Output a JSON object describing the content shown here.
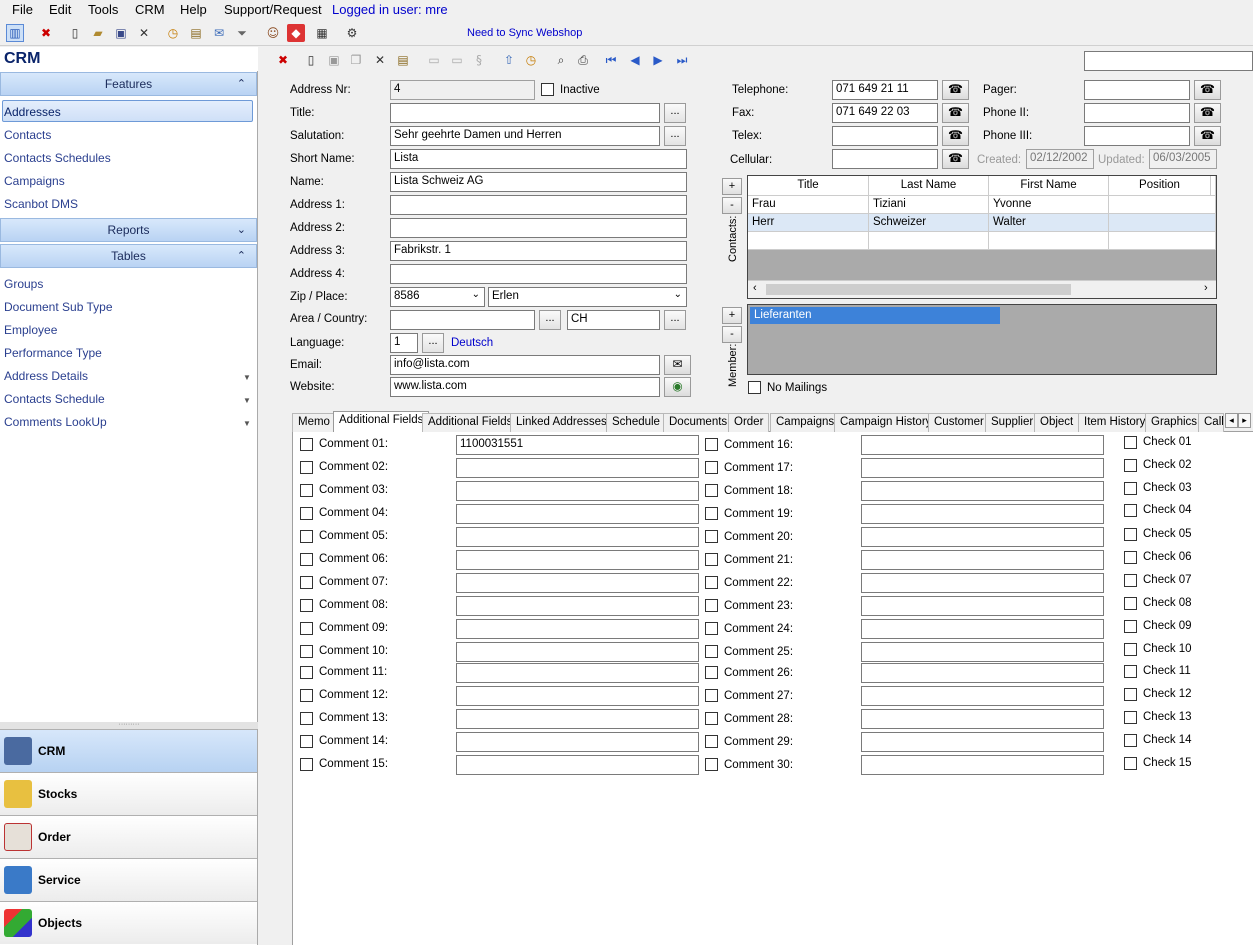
{
  "menu": {
    "items": [
      "File",
      "Edit",
      "Tools",
      "CRM",
      "Help",
      "Support/Request"
    ],
    "login_text": "Logged in user: mre"
  },
  "toolbar": {
    "sync_link": "Need to Sync Webshop"
  },
  "left": {
    "title": "CRM",
    "features_header": "Features",
    "features": [
      "Addresses",
      "Contacts",
      "Contacts  Schedules",
      "Campaigns",
      "Scanbot DMS"
    ],
    "reports_header": "Reports",
    "tables_header": "Tables",
    "tables": [
      "Groups",
      "Document Sub Type",
      "Employee",
      "Performance Type",
      "Address Details",
      "Contacts  Schedule",
      "Comments LookUp"
    ],
    "modules": [
      "CRM",
      "Stocks",
      "Order",
      "Service",
      "Objects"
    ]
  },
  "form": {
    "address_nr_label": "Address Nr:",
    "address_nr": "4",
    "inactive_label": "Inactive",
    "title_label": "Title:",
    "title": "",
    "salutation_label": "Salutation:",
    "salutation": "Sehr geehrte Damen und Herren",
    "short_name_label": "Short Name:",
    "short_name": "Lista",
    "name_label": "Name:",
    "name": "Lista Schweiz AG",
    "address1_label": "Address 1:",
    "address1": "",
    "address2_label": "Address 2:",
    "address2": "",
    "address3_label": "Address 3:",
    "address3": "Fabrikstr. 1",
    "address4_label": "Address 4:",
    "address4": "",
    "zip_label": "Zip / Place:",
    "zip": "8586",
    "place": "Erlen",
    "area_label": "Area / Country:",
    "area": "",
    "country": "CH",
    "language_label": "Language:",
    "language_nr": "1",
    "language_name": "Deutsch",
    "email_label": "Email:",
    "email": "info@lista.com",
    "website_label": "Website:",
    "website": "www.lista.com",
    "telephone_label": "Telephone:",
    "telephone": "071 649 21 11",
    "fax_label": "Fax:",
    "fax": "071 649 22 03",
    "telex_label": "Telex:",
    "telex": "",
    "cellular_label": "Cellular:",
    "cellular": "",
    "pager_label": "Pager:",
    "pager": "",
    "phone2_label": "Phone II:",
    "phone2": "",
    "phone3_label": "Phone III:",
    "phone3": "",
    "created_label": "Created:",
    "created": "02/12/2002",
    "updated_label": "Updated:",
    "updated": "06/03/2005",
    "no_mailings_label": "No Mailings"
  },
  "contacts": {
    "side_label": "Contacts:",
    "headers": [
      "Title",
      "Last Name",
      "First Name",
      "Position"
    ],
    "rows": [
      [
        "Frau",
        "Tiziani",
        "Yvonne",
        ""
      ],
      [
        "Herr",
        "Schweizer",
        "Walter",
        ""
      ]
    ]
  },
  "member": {
    "side_label": "Member:",
    "groups": [
      "Lieferanten"
    ]
  },
  "tabs": [
    "Memo",
    "Additional Fields",
    "Additional Fields",
    "Linked Addresses",
    "Schedule",
    "Documents",
    "Order",
    "Campaigns",
    "Campaign History",
    "Customer",
    "Supplier",
    "Object",
    "Item History",
    "Graphics",
    "Call"
  ],
  "comments": {
    "left": [
      "Comment 01:",
      "Comment 02:",
      "Comment 03:",
      "Comment 04:",
      "Comment 05:",
      "Comment 06:",
      "Comment 07:",
      "Comment 08:",
      "Comment 09:",
      "Comment 10:",
      "Comment 11:",
      "Comment 12:",
      "Comment 13:",
      "Comment 14:",
      "Comment 15:"
    ],
    "left_values": [
      "1100031551",
      "",
      "",
      "",
      "",
      "",
      "",
      "",
      "",
      "",
      "",
      "",
      "",
      "",
      ""
    ],
    "right": [
      "Comment 16:",
      "Comment 17:",
      "Comment 18:",
      "Comment 19:",
      "Comment 20:",
      "Comment 21:",
      "Comment 22:",
      "Comment 23:",
      "Comment 24:",
      "Comment 25:",
      "Comment 26:",
      "Comment 27:",
      "Comment 28:",
      "Comment 29:",
      "Comment 30:"
    ],
    "checks": [
      "Check 01",
      "Check 02",
      "Check 03",
      "Check 04",
      "Check 05",
      "Check 06",
      "Check 07",
      "Check 08",
      "Check 09",
      "Check 10",
      "Check 11",
      "Check 12",
      "Check 13",
      "Check 14",
      "Check 15"
    ]
  },
  "colors": {
    "accent": "#0000cc",
    "nav_text": "#2a3f8f",
    "header_grad": "#b9d3f3",
    "member_sel": "#3d82d9"
  }
}
